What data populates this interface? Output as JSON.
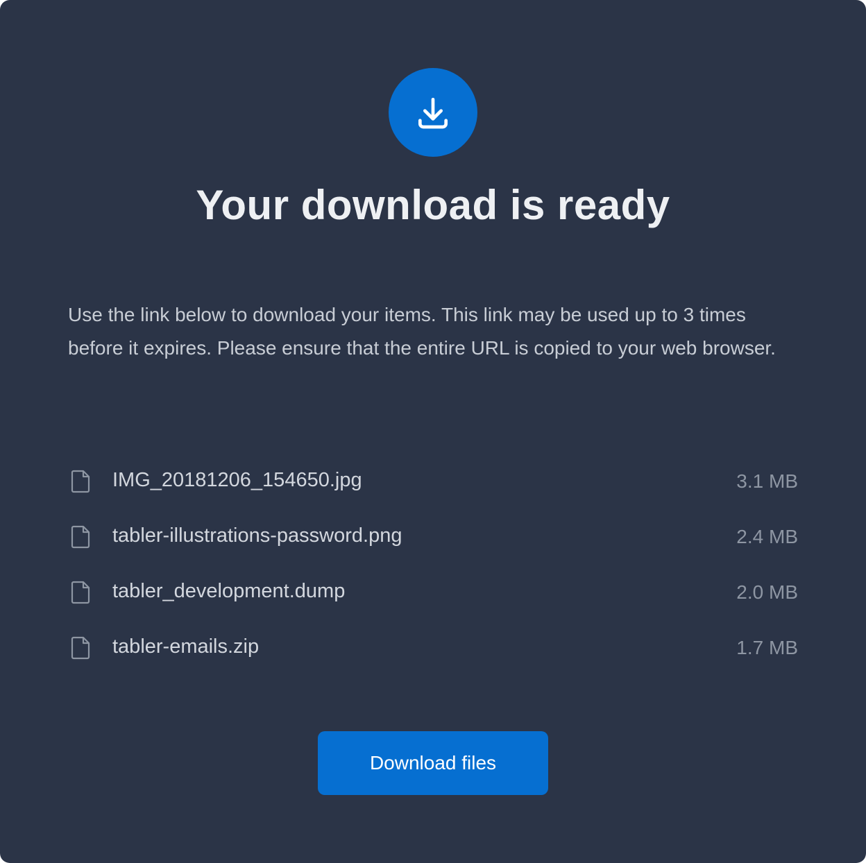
{
  "header": {
    "icon": "download-icon",
    "title": "Your download is ready"
  },
  "description": "Use the link below to download your items. This link may be used up to 3 times before it expires. Please ensure that the entire URL is copied to your web browser.",
  "files": [
    {
      "icon": "file-icon",
      "name": "IMG_20181206_154650.jpg",
      "size": "3.1 MB"
    },
    {
      "icon": "file-icon",
      "name": "tabler-illustrations-password.png",
      "size": "2.4 MB"
    },
    {
      "icon": "file-icon",
      "name": "tabler_development.dump",
      "size": "2.0 MB"
    },
    {
      "icon": "file-icon",
      "name": "tabler-emails.zip",
      "size": "1.7 MB"
    }
  ],
  "actions": {
    "download_label": "Download files"
  },
  "colors": {
    "background": "#2b3447",
    "accent": "#066fd1",
    "title": "#eef0f3",
    "text": "#c8cdd5",
    "muted": "#8e96a3"
  }
}
